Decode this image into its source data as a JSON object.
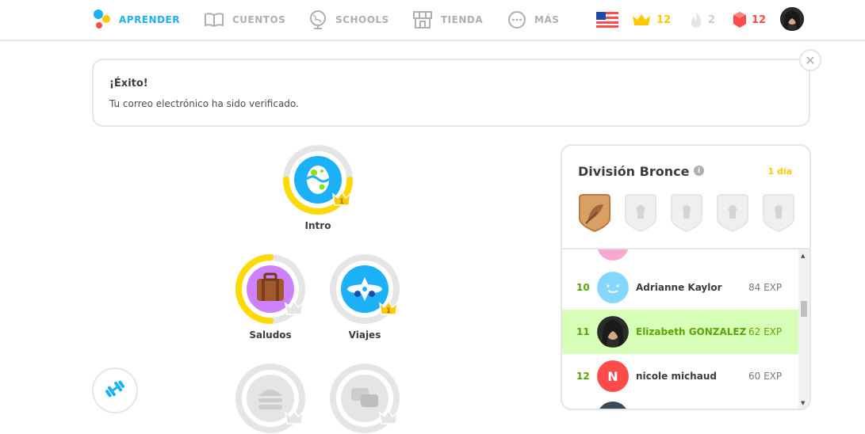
{
  "nav": {
    "learn": "APRENDER",
    "stories": "CUENTOS",
    "schools": "SCHOOLS",
    "shop": "TIENDA",
    "more": "MÁS"
  },
  "stats": {
    "language_flag": "us-flag-icon",
    "crowns": "12",
    "streak": "2",
    "gems": "12"
  },
  "banner": {
    "title": "¡Éxito!",
    "message": "Tu correo electrónico ha sido verificado."
  },
  "skills": [
    {
      "name": "Intro",
      "level": "1",
      "color": "#1cb0f6"
    },
    {
      "name": "Saludos",
      "level": "",
      "color": "#ce82ff"
    },
    {
      "name": "Viajes",
      "level": "1",
      "color": "#1cb0f6"
    }
  ],
  "league": {
    "title": "División Bronce",
    "days_left": "1 día",
    "rows": [
      {
        "rank": "10",
        "name": "Adrianne Kaylor",
        "xp": "84 EXP"
      },
      {
        "rank": "11",
        "name": "Elizabeth GONZALEZ",
        "xp": "62 EXP"
      },
      {
        "rank": "12",
        "avatar_letter": "N",
        "name": "nicole michaud",
        "xp": "60 EXP"
      }
    ]
  },
  "colors": {
    "accent_blue": "#1cb0f6",
    "crown_gold": "#ffc800",
    "gem_red": "#ff4b4b",
    "highlight_green": "#d7ffb8",
    "text_green": "#58a700"
  }
}
